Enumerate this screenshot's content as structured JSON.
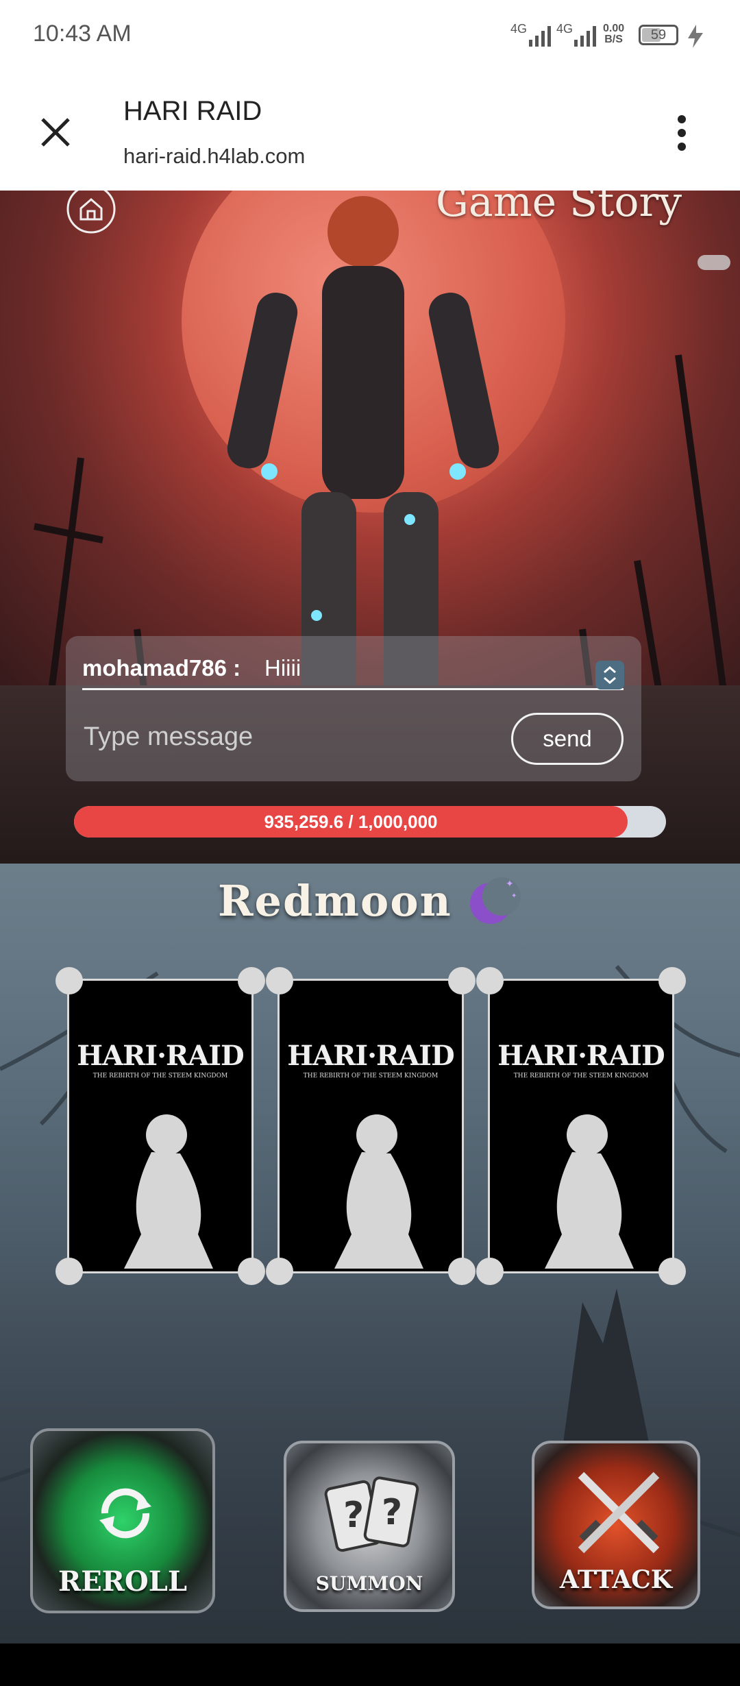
{
  "status_bar": {
    "time": "10:43 AM",
    "network1": "4G",
    "network2": "4G",
    "speed_value": "0.00",
    "speed_unit": "B/S",
    "battery": "59",
    "battery_level": 0.59
  },
  "browser": {
    "title": "HARI RAID",
    "url": "hari-raid.h4lab.com"
  },
  "game": {
    "game_story_label": "Game Story",
    "chat": {
      "username": "mohamad786 :",
      "message": "Hiiii",
      "input_placeholder": "Type message",
      "send_label": "send"
    },
    "hp": {
      "label": "935,259.6 / 1,000,000",
      "current": 935259.6,
      "max": 1000000
    },
    "realm_title": "Redmoon",
    "cards": [
      {
        "brand": "HARI·RAID",
        "subtitle": "THE REBIRTH OF THE STEEM KINGDOM"
      },
      {
        "brand": "HARI·RAID",
        "subtitle": "THE REBIRTH OF THE STEEM KINGDOM"
      },
      {
        "brand": "HARI·RAID",
        "subtitle": "THE REBIRTH OF THE STEEM KINGDOM"
      }
    ],
    "actions": {
      "reroll": "REROLL",
      "summon": "SUMMON",
      "attack": "ATTACK"
    }
  },
  "colors": {
    "hp_fill": "#e84545",
    "hp_track": "#d7dbe2",
    "moon_icon": "#8a4fc9"
  }
}
